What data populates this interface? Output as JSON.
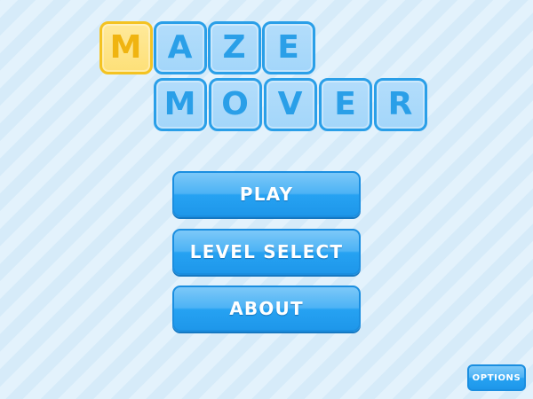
{
  "logo": {
    "row1": [
      "M",
      "A",
      "Z",
      "E"
    ],
    "row2": [
      "M",
      "O",
      "V",
      "E",
      "R"
    ]
  },
  "menu": {
    "play": "PLAY",
    "level_select": "LEVEL SELECT",
    "about": "ABOUT"
  },
  "options": "OPTIONS",
  "colors": {
    "background": "#dceefa",
    "button": "#26a2f2",
    "tile_blue": "#a3d6fa",
    "tile_blue_border": "#2a9fe8",
    "tile_yellow": "#fde078",
    "tile_yellow_border": "#f4c322",
    "label": "#ffffff"
  }
}
